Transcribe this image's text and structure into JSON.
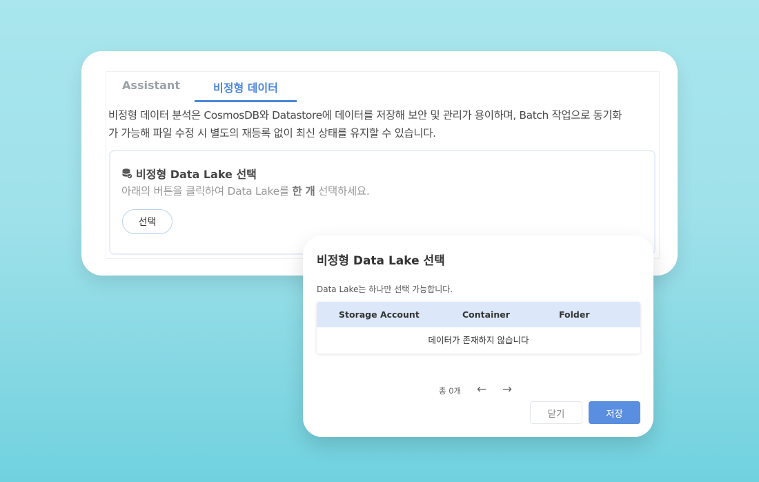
{
  "tabs": [
    {
      "label": "Assistant",
      "active": false
    },
    {
      "label": "비정형 데이터",
      "active": true
    }
  ],
  "description": {
    "line1": "비정형 데이터 분석은 CosmosDB와 Datastore에 데이터를 저장해 보안 및 관리가 용이하며, Batch 작업으로 동기화",
    "line2": "가 가능해 파일 수정 시 별도의 재등록 없이 최신 상태를 유지할 수 있습니다."
  },
  "lake_section": {
    "icon": "database-icon",
    "title": "비정형 Data Lake 선택",
    "subtitle_pre": "아래의 버튼을 클릭하여 Data Lake를 ",
    "subtitle_bold": "한 개",
    "subtitle_post": " 선택하세요.",
    "select_button": "선택"
  },
  "modal": {
    "title": "비정형 Data Lake 선택",
    "note": "Data Lake는 하나만 선택 가능합니다.",
    "table": {
      "columns": [
        "Storage Account",
        "Container",
        "Folder"
      ],
      "empty_message": "데이터가 존재하지 않습니다"
    },
    "pager": {
      "total": "총 0개",
      "prev_icon": "arrow-left-icon",
      "next_icon": "arrow-right-icon"
    },
    "buttons": {
      "close": "닫기",
      "save": "저장"
    }
  },
  "colors": {
    "accent": "#4a86d8",
    "save_button": "#5a8ee0",
    "table_header": "#dce8fa"
  }
}
